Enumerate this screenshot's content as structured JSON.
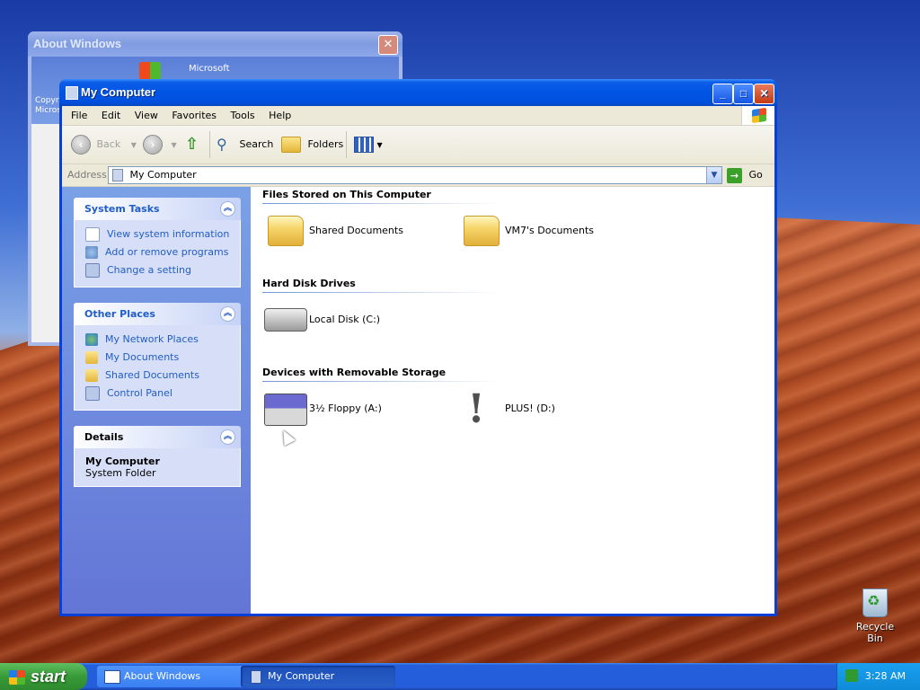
{
  "about_window": {
    "title": "About Windows",
    "logo_text": "Microsoft",
    "copyright_lines": [
      "Copyri",
      "Micros"
    ]
  },
  "window": {
    "title": "My Computer"
  },
  "menu": [
    "File",
    "Edit",
    "View",
    "Favorites",
    "Tools",
    "Help"
  ],
  "toolbar": {
    "back": "Back",
    "search": "Search",
    "folders": "Folders"
  },
  "address": {
    "label": "Address",
    "value": "My Computer",
    "go": "Go"
  },
  "sidebar": {
    "system_tasks": {
      "title": "System Tasks",
      "items": [
        "View system information",
        "Add or remove programs",
        "Change a setting"
      ]
    },
    "other_places": {
      "title": "Other Places",
      "items": [
        "My Network Places",
        "My Documents",
        "Shared Documents",
        "Control Panel"
      ]
    },
    "details": {
      "title": "Details",
      "name": "My Computer",
      "type": "System Folder"
    }
  },
  "groups": {
    "files_stored": {
      "title": "Files Stored on This Computer",
      "items": [
        "Shared Documents",
        "VM7's Documents"
      ]
    },
    "hard_disks": {
      "title": "Hard Disk Drives",
      "items": [
        "Local Disk (C:)"
      ]
    },
    "removable": {
      "title": "Devices with Removable Storage",
      "items": [
        "3½ Floppy (A:)",
        "PLUS! (D:)"
      ]
    }
  },
  "desktop": {
    "recycle_bin": "Recycle Bin"
  },
  "taskbar": {
    "start": "start",
    "tasks": [
      "About Windows",
      "My Computer"
    ],
    "clock": "3:28 AM"
  },
  "icons": {
    "folder": "folder-icon",
    "disk": "hard-disk-icon",
    "floppy": "floppy-drive-icon",
    "unknown_drive": "exclamation-icon"
  }
}
